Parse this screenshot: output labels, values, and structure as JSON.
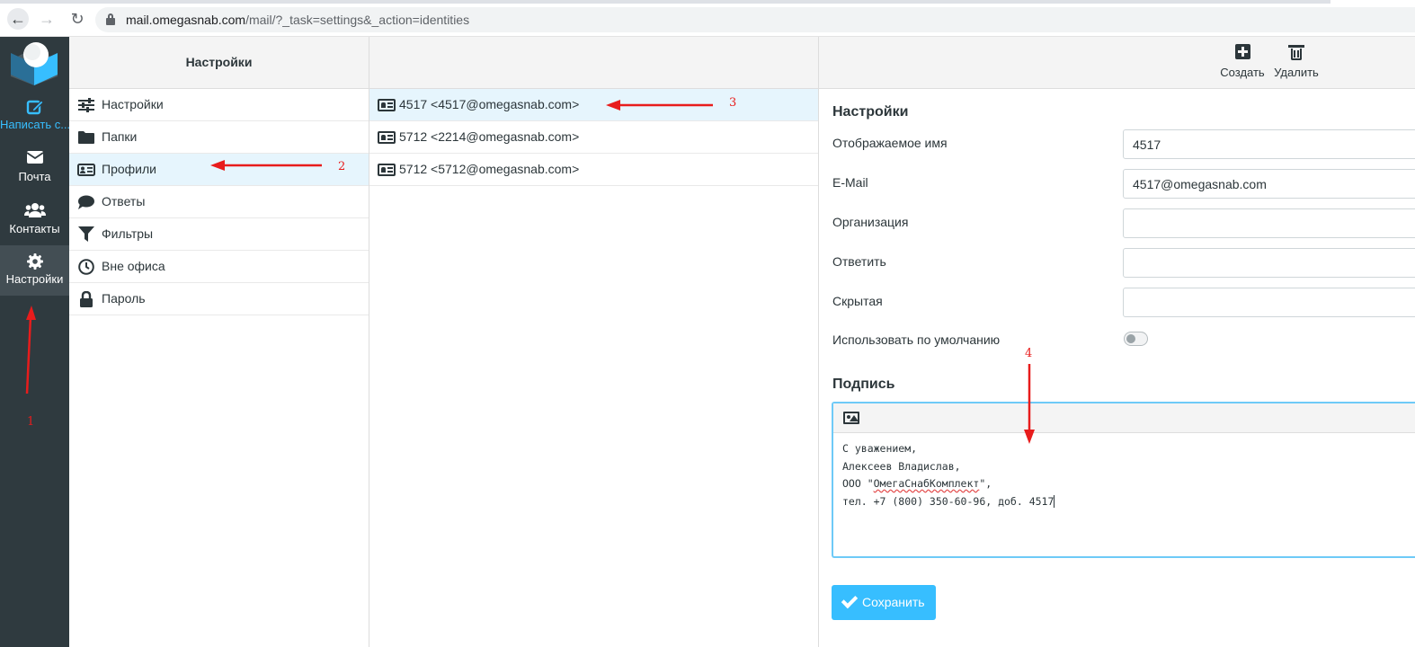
{
  "browser": {
    "url_host": "mail.omegasnab.com",
    "url_path": "/mail/?_task=settings&_action=identities"
  },
  "sidebar": {
    "items": [
      {
        "label": "Написать с...",
        "icon": "compose-icon"
      },
      {
        "label": "Почта",
        "icon": "envelope-icon"
      },
      {
        "label": "Контакты",
        "icon": "users-icon"
      },
      {
        "label": "Настройки",
        "icon": "gear-icon"
      }
    ]
  },
  "settings_column": {
    "title": "Настройки",
    "items": [
      {
        "label": "Настройки",
        "icon": "sliders-icon"
      },
      {
        "label": "Папки",
        "icon": "folder-icon"
      },
      {
        "label": "Профили",
        "icon": "id-card-icon"
      },
      {
        "label": "Ответы",
        "icon": "comment-icon"
      },
      {
        "label": "Фильтры",
        "icon": "filter-icon"
      },
      {
        "label": "Вне офиса",
        "icon": "clock-icon"
      },
      {
        "label": "Пароль",
        "icon": "lock-icon"
      }
    ]
  },
  "identities": {
    "items": [
      {
        "label": "4517 <4517@omegasnab.com>"
      },
      {
        "label": "5712 <2214@omegasnab.com>"
      },
      {
        "label": "5712 <5712@omegasnab.com>"
      }
    ]
  },
  "toolbar": {
    "create_label": "Создать",
    "delete_label": "Удалить"
  },
  "form": {
    "section_title": "Настройки",
    "display_name_label": "Отображаемое имя",
    "display_name_value": "4517",
    "email_label": "E-Mail",
    "email_value": "4517@omegasnab.com",
    "organization_label": "Организация",
    "organization_value": "",
    "reply_to_label": "Ответить",
    "reply_to_value": "",
    "bcc_label": "Скрытая",
    "bcc_value": "",
    "default_label": "Использовать по умолчанию",
    "default_on": false,
    "signature_title": "Подпись",
    "signature_line1": "С уважением,",
    "signature_line2": "Алексеев Владислав,",
    "signature_line3_pre": "ООО \"",
    "signature_line3_word": "ОмегаСнабКомплект",
    "signature_line3_post": "\",",
    "signature_line4": "тел. +7 (800) 350-60-96, доб. 4517",
    "save_label": "Сохранить"
  },
  "annotations": {
    "labels": [
      "1",
      "2",
      "3",
      "4"
    ],
    "color": "#e81c1c"
  },
  "colors": {
    "accent": "#37beff",
    "sidebar_bg": "#2f3a3f",
    "selected_row": "#e6f5fd"
  }
}
